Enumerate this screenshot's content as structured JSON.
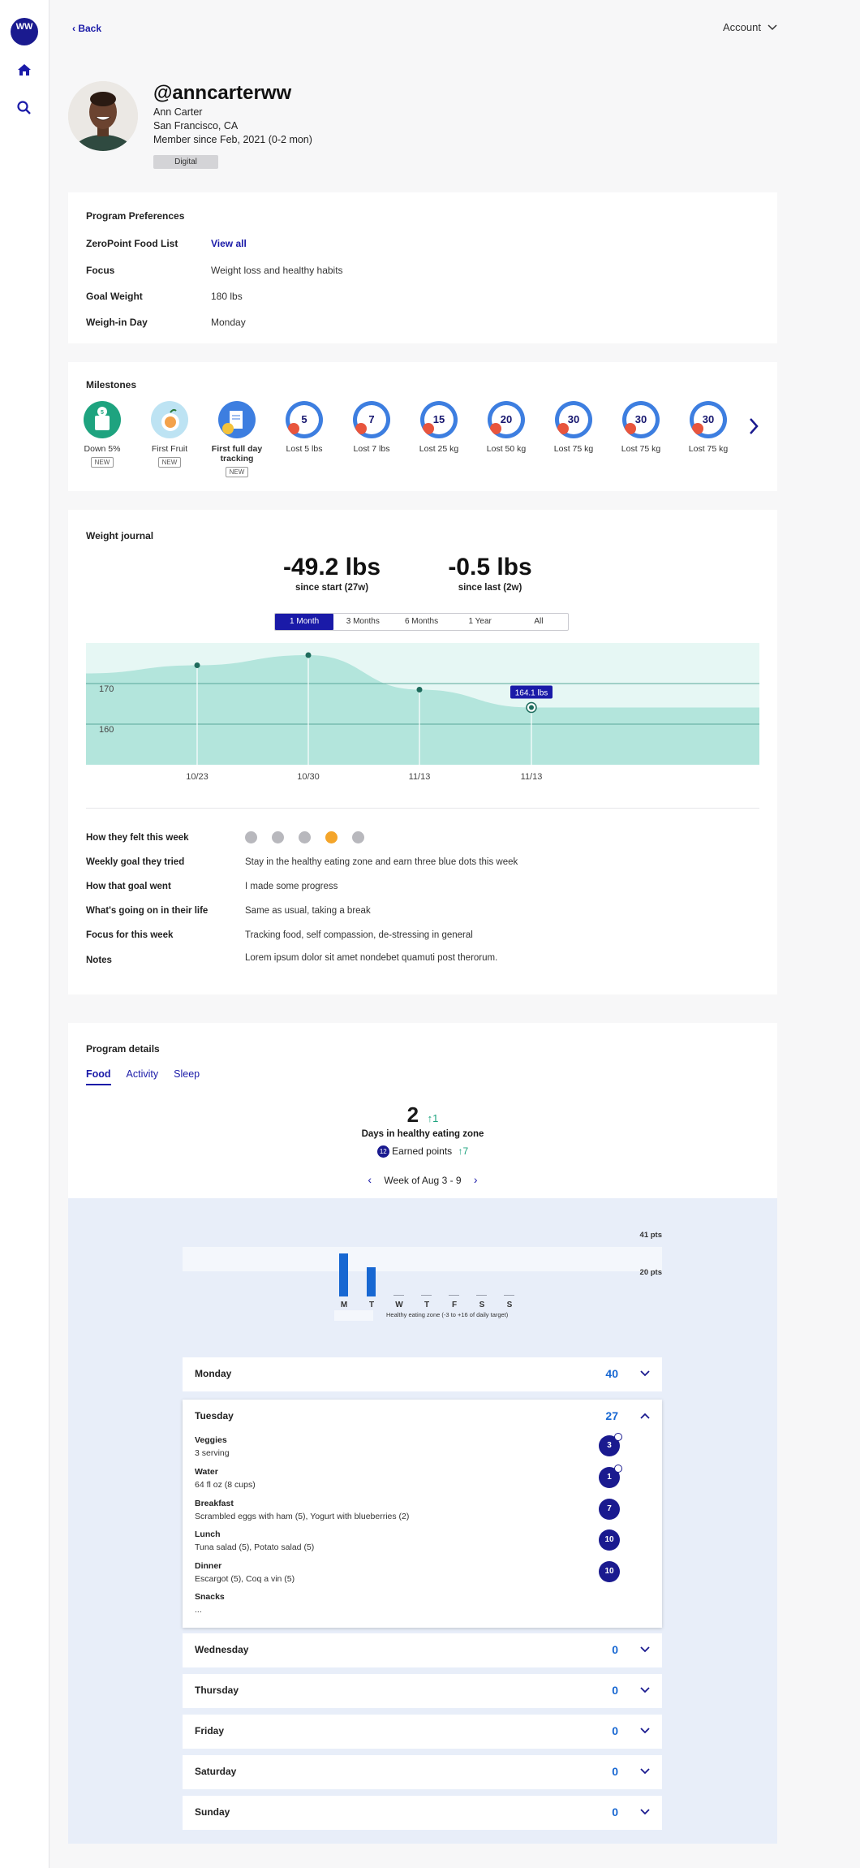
{
  "nav": {
    "logo": "WW",
    "back_label": "Back",
    "account_label": "Account"
  },
  "profile": {
    "handle": "@anncarterww",
    "name": "Ann Carter",
    "location": "San Francisco, CA",
    "member_since": "Member since Feb, 2021 (0-2 mon)",
    "plan_badge": "Digital"
  },
  "preferences": {
    "title": "Program Preferences",
    "rows": [
      {
        "label": "ZeroPoint Food List",
        "value": "View all"
      },
      {
        "label": "Focus",
        "value": "Weight loss and healthy habits"
      },
      {
        "label": "Goal Weight",
        "value": "180 lbs"
      },
      {
        "label": "Weigh-in Day",
        "value": "Monday"
      }
    ]
  },
  "milestones": {
    "title": "Milestones",
    "items": [
      {
        "label": "Down 5%",
        "badge": "NEW",
        "icon": "five-percent"
      },
      {
        "label": "First Fruit",
        "badge": "NEW",
        "icon": "fruit"
      },
      {
        "label": "First full day tracking",
        "badge": "NEW",
        "icon": "tracking"
      },
      {
        "label": "Lost 5 lbs",
        "number": "5"
      },
      {
        "label": "Lost 7 lbs",
        "number": "7"
      },
      {
        "label": "Lost 25 kg",
        "number": "15"
      },
      {
        "label": "Lost 50 kg",
        "number": "20"
      },
      {
        "label": "Lost 75 kg",
        "number": "30"
      },
      {
        "label": "Lost 75 kg",
        "number": "30"
      },
      {
        "label": "Lost 75 kg",
        "number": "30"
      }
    ],
    "colors": {
      "ring": "#3d7ee0",
      "accent": "#e8553d",
      "teal": "#1ea37f"
    }
  },
  "journal": {
    "title": "Weight journal",
    "stat1_value": "-49.2 lbs",
    "stat1_label": "since start (27w)",
    "stat2_value": "-0.5 lbs",
    "stat2_label": "since last (2w)",
    "ranges": [
      "1 Month",
      "3 Months",
      "6 Months",
      "1 Year",
      "All"
    ],
    "active_range": "1 Month",
    "chart_data": {
      "type": "area",
      "x": [
        "10/23",
        "10/30",
        "11/13",
        "11/13"
      ],
      "values": [
        174.5,
        177.0,
        168.5,
        164.1
      ],
      "y_ticks": [
        170,
        160
      ],
      "ylim": [
        150,
        180
      ],
      "highlight_label": "164.1 lbs",
      "colors": {
        "fill": "#b3e5dc",
        "bg": "#e6f7f4",
        "point": "#1e6b5c",
        "tooltip": "#1a1aa8"
      }
    },
    "rows": [
      {
        "label": "How they felt this week",
        "value": ""
      },
      {
        "label": "Weekly goal they tried",
        "value": "Stay in the healthy eating zone and earn three blue dots this week"
      },
      {
        "label": "How that goal went",
        "value": "I made some progress"
      },
      {
        "label": "What's going on in their life",
        "value": "Same as usual, taking a break"
      },
      {
        "label": "Focus for this week",
        "value": "Tracking food, self compassion, de-stressing in general"
      },
      {
        "label": "Notes",
        "value": "Lorem ipsum dolor sit amet nondebet quamuti post therorum."
      }
    ],
    "mood_selected_index": 3
  },
  "program": {
    "title": "Program details",
    "tabs": [
      "Food",
      "Activity",
      "Sleep"
    ],
    "active_tab": "Food",
    "days_value": "2",
    "days_delta": "1",
    "days_label": "Days in healthy eating zone",
    "earned_badge": "12",
    "earned_label": "Earned points",
    "earned_delta": "7",
    "week_label": "Week of Aug 3 - 9",
    "chart_data": {
      "type": "bar",
      "categories": [
        "M",
        "T",
        "W",
        "T",
        "F",
        "S",
        "S"
      ],
      "values": [
        40,
        27,
        0,
        0,
        0,
        0,
        0
      ],
      "top_label": "41 pts",
      "mid_label": "20 pts",
      "legend": "Healthy eating zone (-3 to +16 of daily target)"
    },
    "days": [
      {
        "name": "Monday",
        "points": "40",
        "expanded": false
      },
      {
        "name": "Tuesday",
        "points": "27",
        "expanded": true,
        "meals": [
          {
            "name": "Veggies",
            "desc": "3 serving",
            "pts": "3",
            "plus": true
          },
          {
            "name": "Water",
            "desc": "64 fl oz (8 cups)",
            "pts": "1",
            "plus": true
          },
          {
            "name": "Breakfast",
            "desc": "Scrambled eggs with ham (5), Yogurt with blueberries (2)",
            "pts": "7",
            "plus": false
          },
          {
            "name": "Lunch",
            "desc": "Tuna salad (5), Potato salad (5)",
            "pts": "10",
            "plus": false
          },
          {
            "name": "Dinner",
            "desc": "Escargot (5), Coq a vin (5)",
            "pts": "10",
            "plus": false
          },
          {
            "name": "Snacks",
            "desc": "...",
            "pts": "",
            "plus": false
          }
        ]
      },
      {
        "name": "Wednesday",
        "points": "0",
        "expanded": false
      },
      {
        "name": "Thursday",
        "points": "0",
        "expanded": false
      },
      {
        "name": "Friday",
        "points": "0",
        "expanded": false
      },
      {
        "name": "Saturday",
        "points": "0",
        "expanded": false
      },
      {
        "name": "Sunday",
        "points": "0",
        "expanded": false
      }
    ]
  }
}
